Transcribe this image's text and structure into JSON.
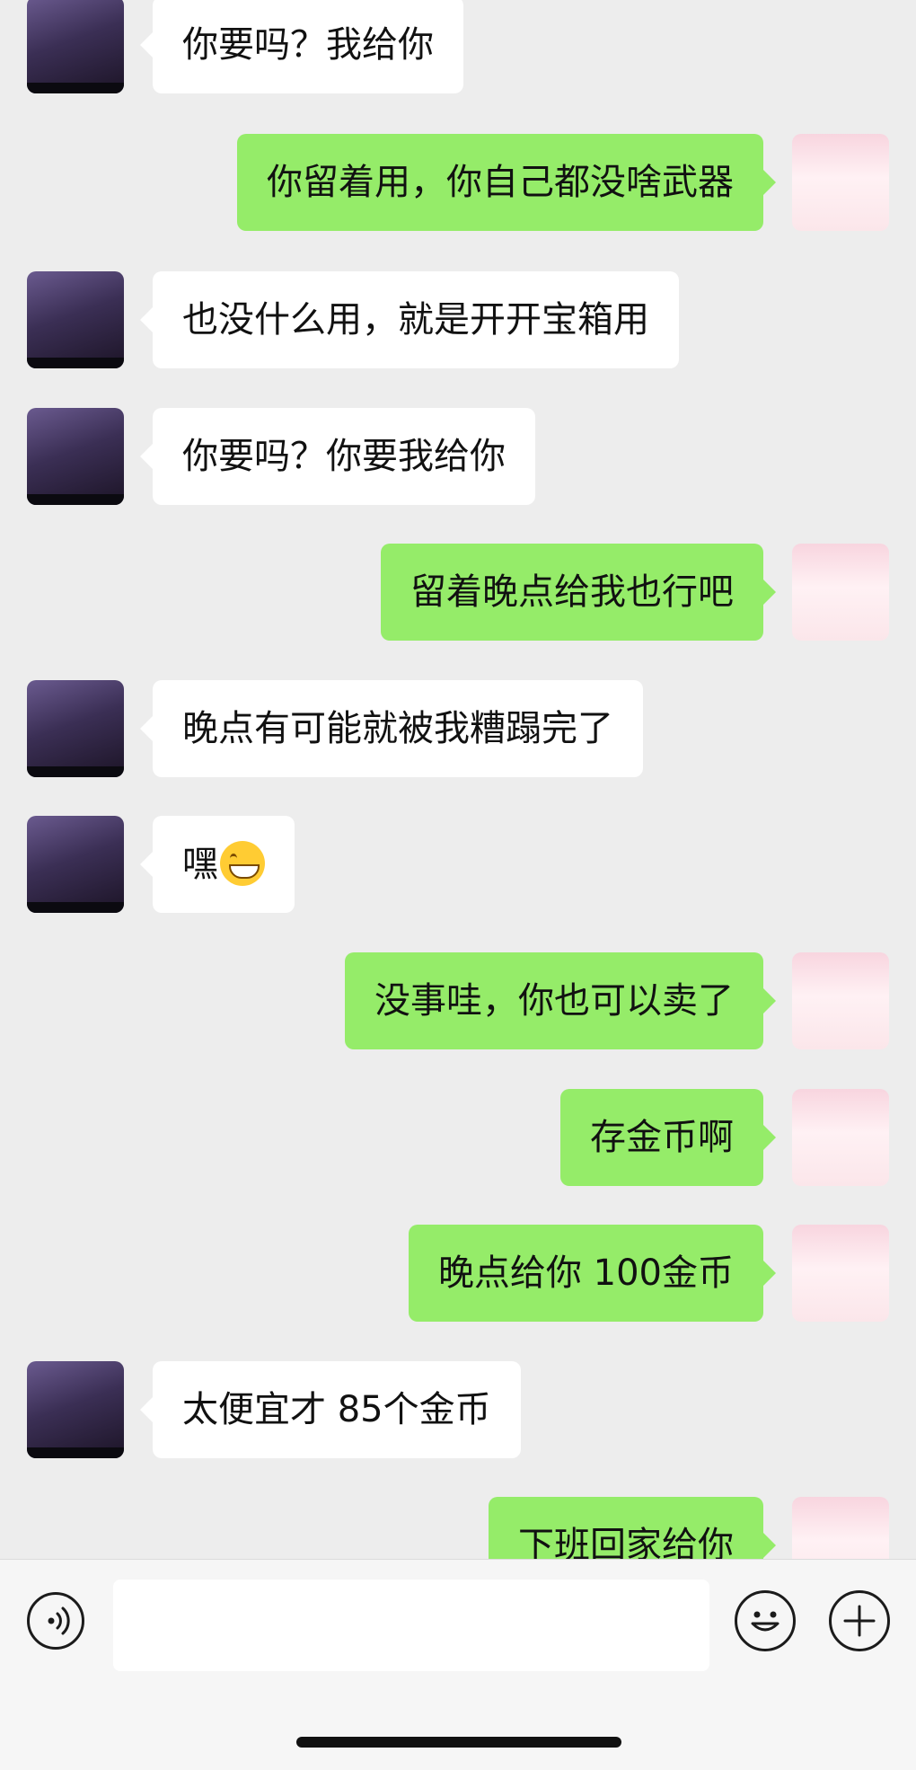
{
  "messages": [
    {
      "side": "in",
      "text": "你要吗？我给你"
    },
    {
      "side": "out",
      "text": "你留着用，你自己都没啥武器"
    },
    {
      "side": "in",
      "text": "也没什么用，就是开开宝箱用"
    },
    {
      "side": "in",
      "text": "你要吗？你要我给你"
    },
    {
      "side": "out",
      "text": "留着晚点给我也行吧"
    },
    {
      "side": "in",
      "text": "晚点有可能就被我糟蹋完了"
    },
    {
      "side": "in",
      "text": "嘿",
      "emoji": "grinning-face"
    },
    {
      "side": "out",
      "text": "没事哇，你也可以卖了"
    },
    {
      "side": "out",
      "text": "存金币啊"
    },
    {
      "side": "out",
      "text": "晚点给你 100金币"
    },
    {
      "side": "in",
      "text": "太便宜才 85个金币"
    },
    {
      "side": "out",
      "text": "下班回家给你"
    }
  ],
  "input_bar": {
    "voice_icon": "voice-icon",
    "input_value": "",
    "emoji_icon": "smiley-icon",
    "plus_icon": "plus-icon"
  },
  "colors": {
    "background": "#ededed",
    "incoming_bubble": "#ffffff",
    "outgoing_bubble": "#95ec69"
  }
}
